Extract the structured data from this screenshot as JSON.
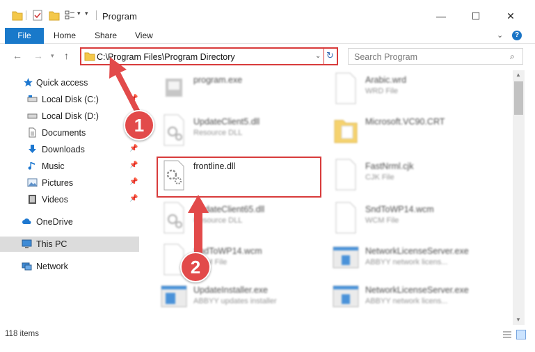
{
  "window": {
    "title": "Program",
    "min_symbol": "—",
    "max_symbol": "☐",
    "close_symbol": "✕"
  },
  "ribbon": {
    "file": "File",
    "home": "Home",
    "share": "Share",
    "view": "View",
    "help": "?"
  },
  "address": {
    "path": "C:\\Program Files\\Program Directory"
  },
  "search": {
    "placeholder": "Search Program"
  },
  "sidebar": {
    "items": [
      {
        "label": "Quick access",
        "icon": "star-icon"
      },
      {
        "label": "Local Disk (C:)",
        "icon": "drive-icon"
      },
      {
        "label": "Local Disk (D:)",
        "icon": "drive-icon"
      },
      {
        "label": "Documents",
        "icon": "documents-icon"
      },
      {
        "label": "Downloads",
        "icon": "download-icon"
      },
      {
        "label": "Music",
        "icon": "music-icon"
      },
      {
        "label": "Pictures",
        "icon": "pictures-icon"
      },
      {
        "label": "Videos",
        "icon": "videos-icon"
      },
      {
        "label": "OneDrive",
        "icon": "cloud-icon"
      },
      {
        "label": "This PC",
        "icon": "computer-icon"
      },
      {
        "label": "Network",
        "icon": "network-icon"
      }
    ]
  },
  "files": [
    {
      "name": "program.exe",
      "desc": "",
      "type": "exe"
    },
    {
      "name": "Arabic.wrd",
      "desc": "WRD File",
      "type": "doc"
    },
    {
      "name": "UpdateClient5.dll",
      "desc": "Resource DLL",
      "type": "dll"
    },
    {
      "name": "Microsoft.VC90.CRT",
      "desc": "",
      "type": "folder"
    },
    {
      "name": "frontline.dll",
      "desc": "",
      "type": "dll"
    },
    {
      "name": "FastNrml.cjk",
      "desc": "CJK File",
      "type": "doc"
    },
    {
      "name": "UpdateClient65.dll",
      "desc": "Resource DLL",
      "type": "dll"
    },
    {
      "name": "SndToWP14.wcm",
      "desc": "WCM File",
      "type": "doc"
    },
    {
      "name": "SndToWP14.wcm",
      "desc": "WCM File",
      "type": "doc"
    },
    {
      "name": "NetworkLicenseServer.exe",
      "desc": "ABBYY network licens...",
      "type": "app"
    },
    {
      "name": "UpdateInstaller.exe",
      "desc": "ABBYY updates installer",
      "type": "app"
    },
    {
      "name": "NetworkLicenseServer.exe",
      "desc": "ABBYY network licens...",
      "type": "app"
    }
  ],
  "status": {
    "item_count": "118 items"
  },
  "annotations": {
    "step1": "1",
    "step2": "2",
    "color": "#e24a4a"
  },
  "colors": {
    "accent": "#1979ca",
    "highlight": "#d83b3b"
  }
}
